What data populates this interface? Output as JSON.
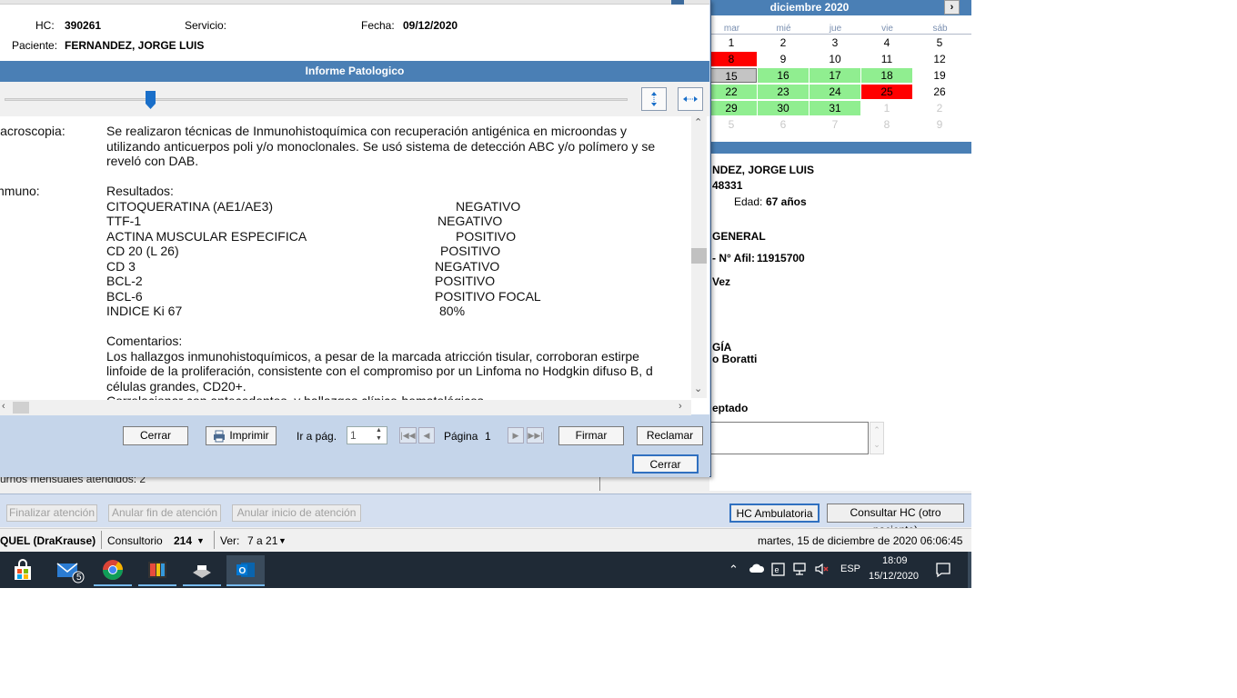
{
  "calendar": {
    "month_title": "diciembre 2020",
    "next_arrow": "›",
    "weekdays": [
      "mar",
      "mié",
      "jue",
      "vie",
      "sáb"
    ],
    "rows": [
      [
        "8",
        "9",
        "10",
        "11",
        "12"
      ],
      [
        "15",
        "16",
        "17",
        "18",
        "19"
      ],
      [
        "22",
        "23",
        "24",
        "25",
        "26"
      ],
      [
        "29",
        "30",
        "31",
        "1",
        "2"
      ],
      [
        "5",
        "6",
        "7",
        "8",
        "9"
      ]
    ],
    "first_row": [
      "1",
      "2",
      "3",
      "4",
      "5"
    ],
    "colors": {
      "attended": "#90ee90",
      "blocked": "#ff0000",
      "today": "#c4c4c4"
    }
  },
  "patient_panel": {
    "name_fragment": "NDEZ, JORGE LUIS",
    "id_fragment": "48331",
    "age_label": "Edad:",
    "age_value": "67 años",
    "service_fragment": "GENERAL",
    "afil_label": "- N° Afil:",
    "afil_value": "11915700",
    "vez_fragment": "Vez",
    "specialty_fragment": "GÍA",
    "doctor_fragment": "o Boratti",
    "status_fragment": "eptado"
  },
  "turnos_text": "urnos mensuales atendidos: 2",
  "bottom_actions": {
    "finalizar": "Finalizar atención",
    "anular_fin": "Anular fin de atención",
    "anular_inicio": "Anular inicio de atención",
    "hc_ambulatoria": "HC Ambulatoria",
    "consultar_hc": "Consultar HC (otro paciente)"
  },
  "status_bar": {
    "user": "QUEL (DraKrause)",
    "consultorio_label": "Consultorio",
    "consultorio_value": "214",
    "ver_label": "Ver:",
    "ver_value": "7 a 21",
    "datetime": "martes, 15 de diciembre de 2020  06:06:45"
  },
  "dialog": {
    "hc_label": "HC:",
    "hc_value": "390261",
    "servicio_label": "Servicio:",
    "fecha_label": "Fecha:",
    "fecha_value": "09/12/2020",
    "paciente_label": "Paciente:",
    "paciente_value": "FERNANDEZ, JORGE LUIS",
    "title": "Informe Patologico",
    "buttons": {
      "cerrar": "Cerrar",
      "imprimir": "Imprimir",
      "ir_pag_label": "Ir a pág.",
      "ir_pag_value": "1",
      "pagina_label": "Página",
      "pagina_value": "1",
      "firmar": "Firmar",
      "reclamar": "Reclamar",
      "cerrar_bottom": "Cerrar"
    }
  },
  "report": {
    "macro_label": "lacroscopia:",
    "macro_lines": [
      "Se realizaron técnicas de Inmunohistoquímica con recuperación antigénica en microondas y",
      "utilizando anticuerpos poli y/o monoclonales. Se usó sistema de detección ABC y/o polímero y se",
      "reveló con DAB."
    ],
    "inmuno_label": "nmuno:",
    "resultados_label": "Resultados:",
    "results": [
      {
        "marker": "CITOQUERATINA (AE1/AE3)",
        "value": "NEGATIVO"
      },
      {
        "marker": "TTF-1",
        "value": "NEGATIVO"
      },
      {
        "marker": "ACTINA MUSCULAR ESPECIFICA",
        "value": "POSITIVO"
      },
      {
        "marker": "CD 20 (L 26)",
        "value": "POSITIVO"
      },
      {
        "marker": "CD 3",
        "value": "NEGATIVO"
      },
      {
        "marker": "BCL-2",
        "value": "POSITIVO"
      },
      {
        "marker": "BCL-6",
        "value": "POSITIVO FOCAL"
      },
      {
        "marker": "INDICE Ki 67",
        "value": "80%"
      }
    ],
    "comentarios_label": "Comentarios:",
    "comment_lines": [
      "Los hallazgos inmunohistoquímicos, a pesar de la marcada atricción tisular, corroboran estirpe",
      "linfoide de la proliferación, consistente con el compromiso por un Linfoma no Hodgkin difuso B, d",
      "células grandes, CD20+.",
      "Correlacionar con antecedentes, y hallazgos clínico-hematológicos."
    ]
  },
  "taskbar": {
    "mail_badge": "5",
    "lang": "ESP",
    "time": "18:09",
    "date": "15/12/2020"
  }
}
